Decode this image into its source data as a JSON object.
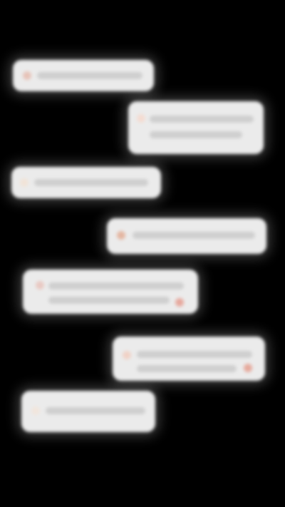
{
  "background_color": "#000000",
  "bubble_color": "#ebebeb",
  "messages": [
    {
      "side": "left",
      "text": "",
      "emoji_icon": "face-emoji-icon"
    },
    {
      "side": "right",
      "text": "",
      "emoji_icon": "face-emoji-icon"
    },
    {
      "side": "left",
      "text": "",
      "emoji_icon": "face-emoji-icon"
    },
    {
      "side": "right",
      "text": "",
      "emoji_icon": "face-emoji-icon"
    },
    {
      "side": "left",
      "text": "",
      "emoji_icon": "face-emoji-icon"
    },
    {
      "side": "right",
      "text": "",
      "emoji_icon": "face-emoji-icon"
    },
    {
      "side": "left",
      "text": "",
      "emoji_icon": "face-emoji-icon"
    }
  ]
}
